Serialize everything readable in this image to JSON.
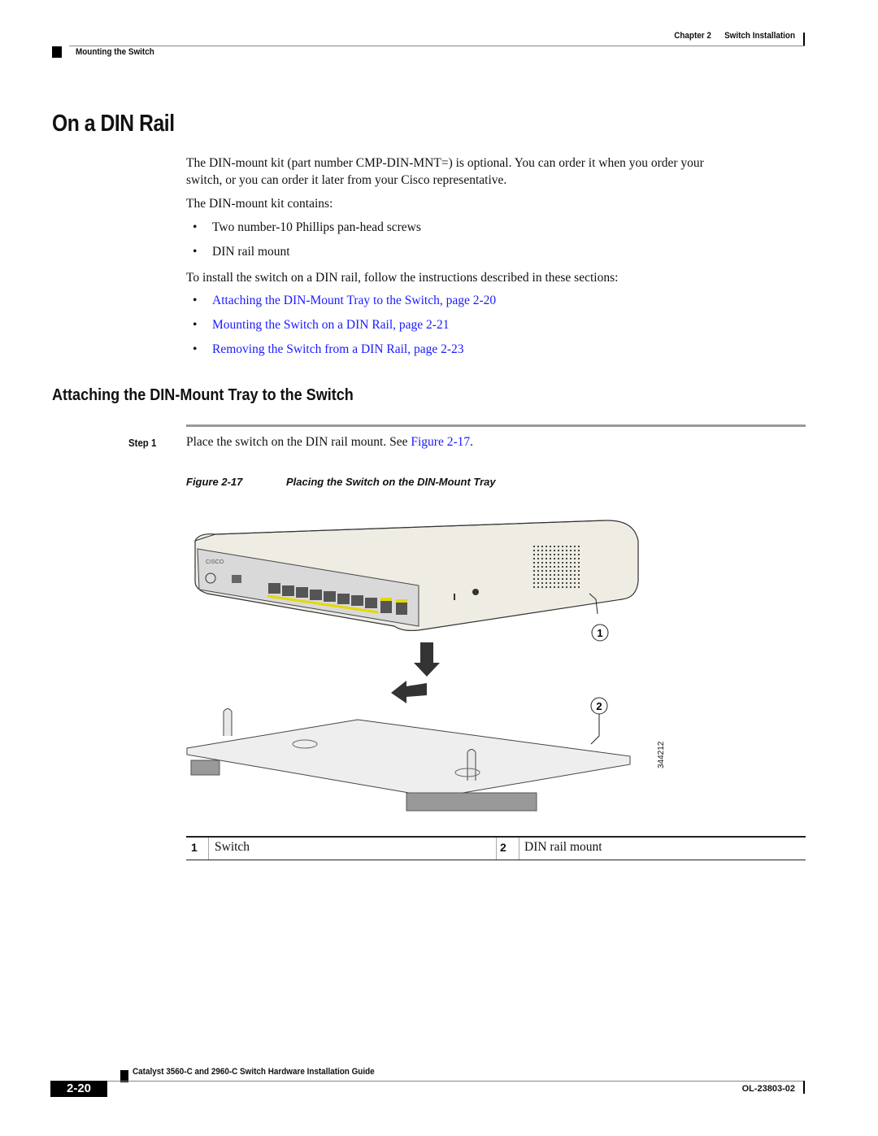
{
  "header": {
    "chapter_label": "Chapter 2",
    "chapter_title": "Switch Installation",
    "section": "Mounting the Switch"
  },
  "title": "On a DIN Rail",
  "intro": {
    "paragraph1_line1": "The DIN-mount kit (part number CMP-DIN-MNT=) is optional. You can order it when you order your",
    "paragraph1_line2": "switch, or you can order it later from your Cisco representative.",
    "kit_contains": "The DIN-mount kit contains:",
    "kit_items": [
      "Two number-10 Phillips pan-head screws",
      "DIN rail mount"
    ],
    "instructions": "To install the switch on a DIN rail, follow the instructions described in these sections:",
    "links": [
      "Attaching the DIN-Mount Tray to the Switch, page 2-20",
      "Mounting the Switch on a DIN Rail, page 2-21",
      "Removing the Switch from a DIN Rail, page 2-23"
    ],
    "bullet": "•"
  },
  "section2": {
    "heading": "Attaching the DIN-Mount Tray to the Switch",
    "step_label": "Step 1",
    "step_text": "Place the switch on the DIN rail mount. See ",
    "step_link": "Figure 2-17",
    "step_end": "."
  },
  "figure": {
    "number": "Figure 2-17",
    "title": "Placing the Switch on the DIN-Mount Tray",
    "callouts": [
      "1",
      "2"
    ],
    "image_id": "344212",
    "legend": [
      {
        "num": "1",
        "label": "Switch"
      },
      {
        "num": "2",
        "label": "DIN rail mount"
      }
    ]
  },
  "footer": {
    "guide_title": "Catalyst 3560-C and 2960-C Switch Hardware Installation Guide",
    "page": "2-20",
    "doc_number": "OL-23803-02"
  }
}
